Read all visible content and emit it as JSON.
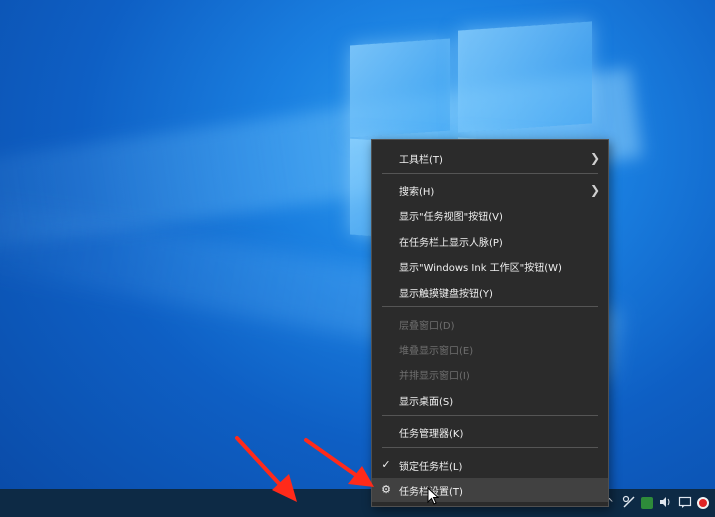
{
  "desktop": {
    "background_color": "#1a7fe0",
    "logo_icon": "windows-logo-icon"
  },
  "context_menu": {
    "groups": [
      [
        {
          "label": "工具栏(T)",
          "has_submenu": true,
          "enabled": true
        }
      ],
      [
        {
          "label": "搜索(H)",
          "has_submenu": true,
          "enabled": true
        },
        {
          "label": "显示\"任务视图\"按钮(V)",
          "enabled": true
        },
        {
          "label": "在任务栏上显示人脉(P)",
          "enabled": true
        },
        {
          "label": "显示\"Windows Ink 工作区\"按钮(W)",
          "enabled": true
        },
        {
          "label": "显示触摸键盘按钮(Y)",
          "enabled": true
        }
      ],
      [
        {
          "label": "层叠窗口(D)",
          "enabled": false
        },
        {
          "label": "堆叠显示窗口(E)",
          "enabled": false
        },
        {
          "label": "并排显示窗口(I)",
          "enabled": false
        },
        {
          "label": "显示桌面(S)",
          "enabled": true
        }
      ],
      [
        {
          "label": "任务管理器(K)",
          "enabled": true
        }
      ],
      [
        {
          "label": "锁定任务栏(L)",
          "checked": true,
          "enabled": true
        },
        {
          "label": "任务栏设置(T)",
          "icon": "gear-icon",
          "hovered": true,
          "enabled": true
        }
      ]
    ]
  },
  "taskbar": {
    "color": "#0d2a45",
    "tray_icons": [
      "chevron-up-icon",
      "network-icon",
      "security-shield-icon",
      "volume-icon",
      "notification-icon",
      "record-icon"
    ]
  },
  "annotation_color": "#ff2a1a"
}
